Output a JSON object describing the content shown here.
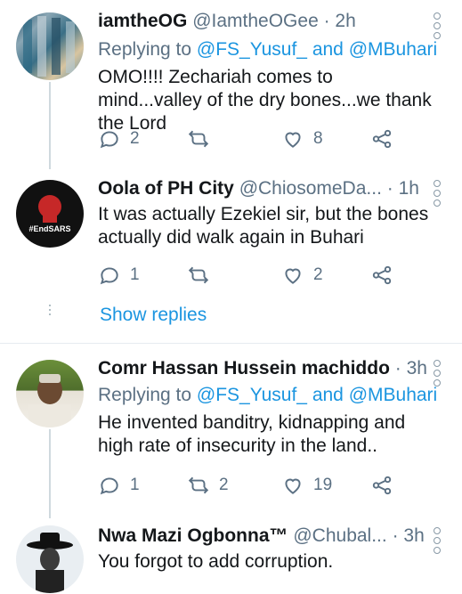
{
  "tweets": [
    {
      "name": "iamtheOG",
      "handle": "@IamtheOGee",
      "time": "· 2h",
      "replying_prefix": "Replying to",
      "reply_mention_1": "@FS_Yusuf_",
      "reply_and": "and",
      "reply_mention_2": "@MBuhari",
      "text": "OMO!!!! Zechariah comes to mind...valley of the dry bones...we thank the Lord",
      "replies": "2",
      "retweets": "",
      "likes": "8"
    },
    {
      "name": "Oola of PH City",
      "handle": "@ChiosomeDa...",
      "time": "· 1h",
      "text": "It was actually Ezekiel sir, but the bones actually did walk again in Buhari",
      "replies": "1",
      "retweets": "",
      "likes": "2",
      "avatar_text": "#EndSARS",
      "show_replies": "Show replies"
    },
    {
      "name": "Comr Hassan Hussein machiddo",
      "handle": "",
      "time": "· 3h",
      "replying_prefix": "Replying to",
      "reply_mention_1": "@FS_Yusuf_",
      "reply_and": "and",
      "reply_mention_2": "@MBuhari",
      "text": "He invented banditry, kidnapping and high rate of insecurity in the land..",
      "replies": "1",
      "retweets": "2",
      "likes": "19"
    },
    {
      "name": "Nwa Mazi Ogbonna™",
      "handle": "@Chubal...",
      "time": "· 3h",
      "text": "You forgot to add corruption."
    }
  ],
  "icons": [
    "reply-icon",
    "retweet-icon",
    "like-icon",
    "share-icon",
    "more-icon"
  ],
  "colors": {
    "link": "#1b95e0",
    "secondary": "#5b7083",
    "text": "#14171a"
  }
}
